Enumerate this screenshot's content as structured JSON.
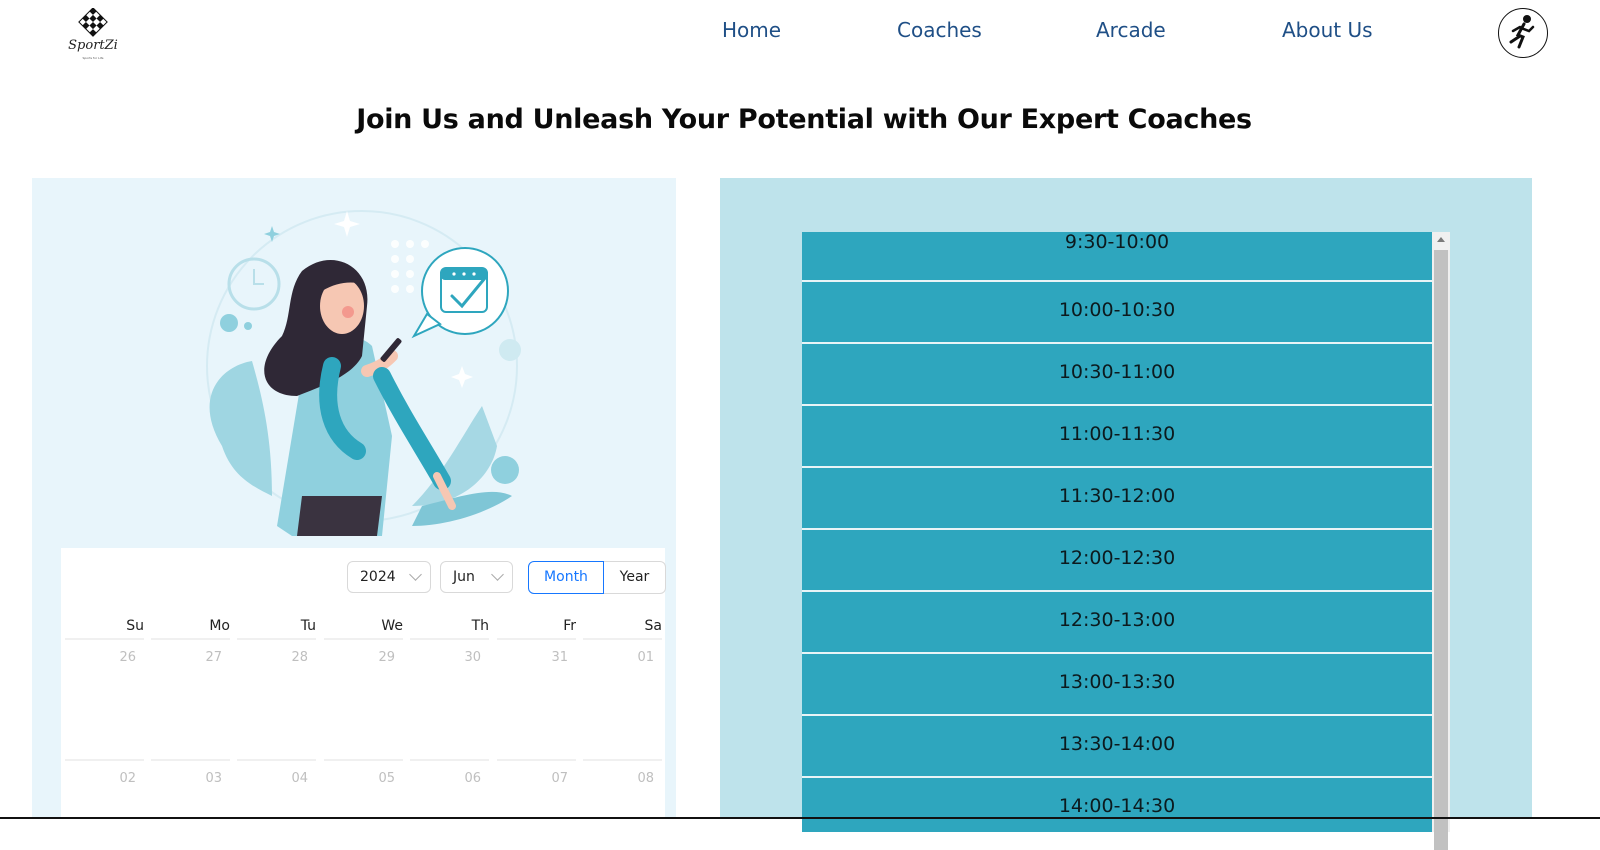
{
  "brand": {
    "name": "SportZi",
    "tagline": "Sports for Life"
  },
  "nav": {
    "items": [
      "Home",
      "Coaches",
      "Arcade",
      "About Us"
    ]
  },
  "icons": {
    "logo": "checkered-diamond-logo",
    "avatar": "runner-icon",
    "illustration": "woman-scheduling-illustration"
  },
  "page_title": "Join Us and Unleash Your Potential with Our Expert Coaches",
  "calendar": {
    "year": "2024",
    "month": "Jun",
    "mode_month": "Month",
    "mode_year": "Year",
    "selected_mode": "Month",
    "weekdays": [
      "Su",
      "Mo",
      "Tu",
      "We",
      "Th",
      "Fr",
      "Sa"
    ],
    "weeks": [
      [
        "26",
        "27",
        "28",
        "29",
        "30",
        "31",
        "01"
      ],
      [
        "02",
        "03",
        "04",
        "05",
        "06",
        "07",
        "08"
      ]
    ]
  },
  "time_slots": [
    "9:30-10:00",
    "10:00-10:30",
    "10:30-11:00",
    "11:00-11:30",
    "11:30-12:00",
    "12:00-12:30",
    "12:30-13:00",
    "13:00-13:30",
    "13:30-14:00",
    "14:00-14:30"
  ],
  "colors": {
    "nav": "#1f4f86",
    "slot": "#2ea6be",
    "right_panel": "#bee3eb",
    "left_panel": "#e8f5fb",
    "accent": "#1677ff"
  }
}
